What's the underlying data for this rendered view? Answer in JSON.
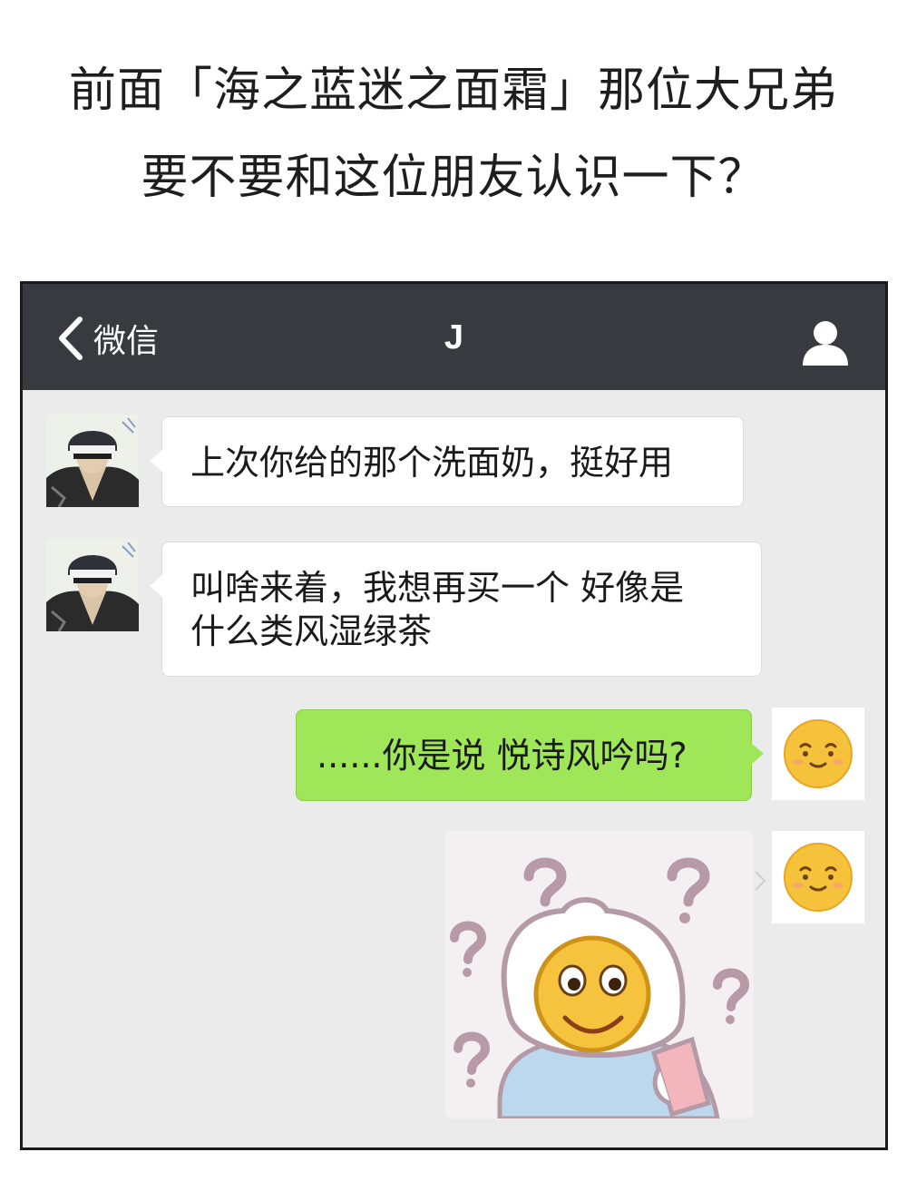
{
  "caption": {
    "line1": "前面「海之蓝迷之面霜」那位大兄弟",
    "line2": "要不要和这位朋友认识一下？"
  },
  "navbar": {
    "back_label": "微信",
    "title": "J",
    "back_icon": "chevron-left-icon",
    "profile_icon": "person-icon",
    "background": "#393a3f"
  },
  "messages": [
    {
      "sender": "J",
      "direction": "incoming",
      "text": "上次你给的那个洗面奶，挺好用"
    },
    {
      "sender": "J",
      "direction": "incoming",
      "lines": [
        "叫啥来着，我想再买一个  好像是",
        "什么类风湿绿茶"
      ]
    },
    {
      "sender": "me",
      "direction": "outgoing",
      "text": "......你是说 悦诗风吟吗?"
    },
    {
      "sender": "me",
      "direction": "outgoing",
      "type": "sticker",
      "sticker": "confused-smiley-sticker"
    }
  ],
  "colors": {
    "chat_background": "#ebebeb",
    "incoming_bubble": "#ffffff",
    "outgoing_bubble": "#9fe658"
  }
}
